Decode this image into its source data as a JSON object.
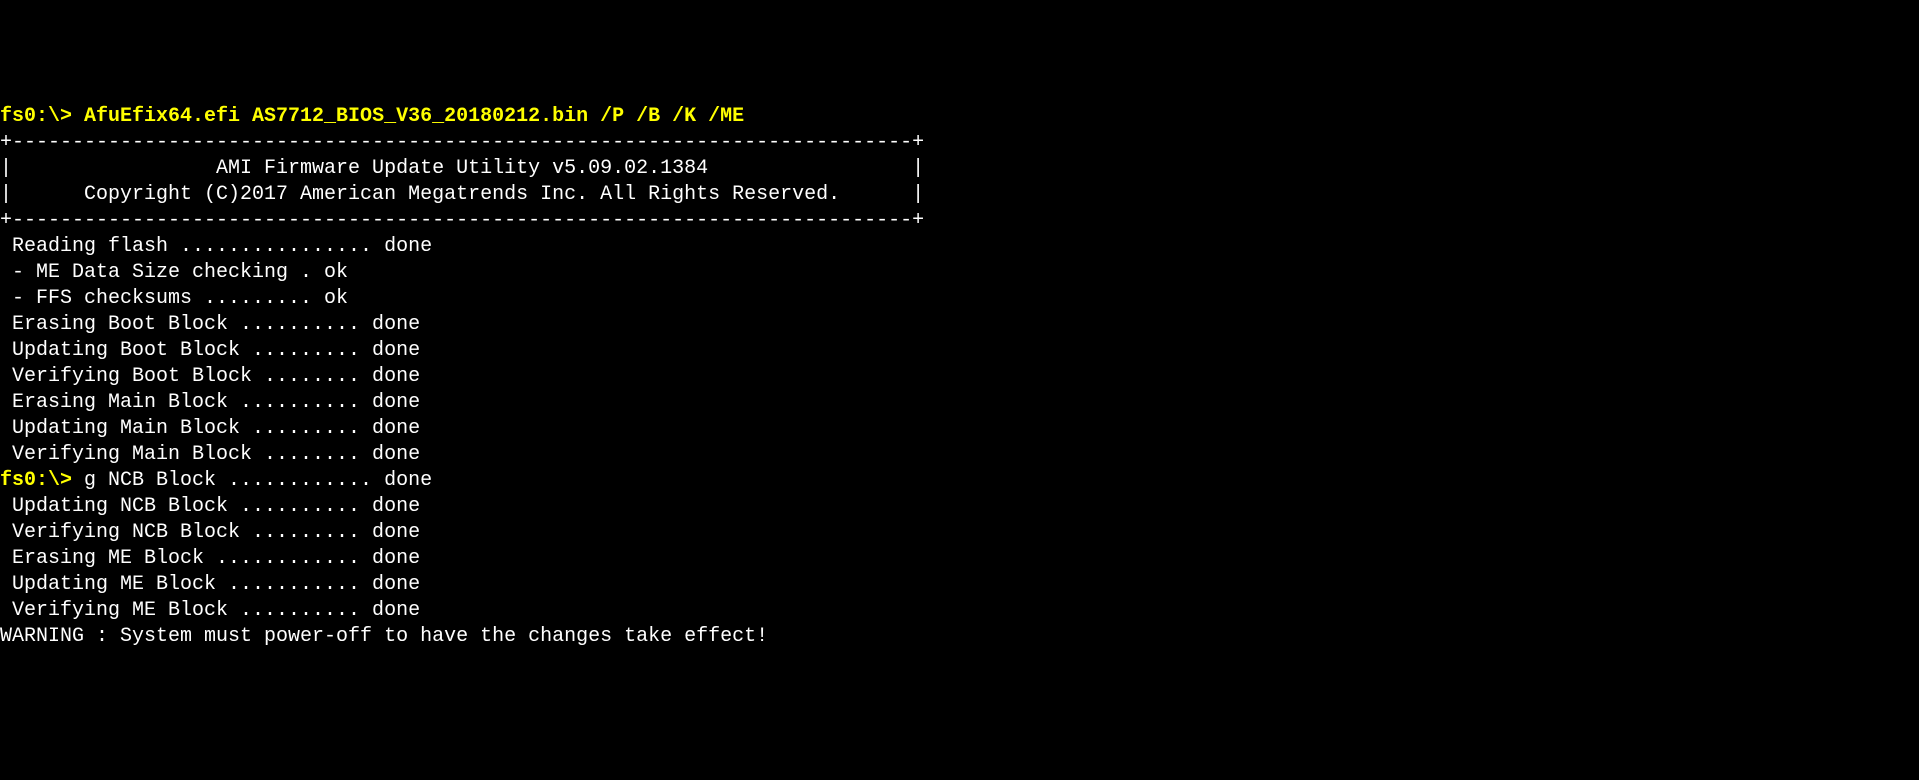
{
  "prompt1": {
    "prefix": "fs0:\\> ",
    "cmd": "AfuEfix64.efi AS7712_BIOS_V36_20180212.bin /P /B /K /ME"
  },
  "header": {
    "border_top": "+---------------------------------------------------------------------------+",
    "title": "|                 AMI Firmware Update Utility v5.09.02.1384                 |",
    "copyright": "|      Copyright (C)2017 American Megatrends Inc. All Rights Reserved.      |",
    "border_bottom": "+---------------------------------------------------------------------------+"
  },
  "lines": [
    " Reading flash ................ done",
    " - ME Data Size checking . ok",
    " - FFS checksums ......... ok",
    " Erasing Boot Block .......... done",
    " Updating Boot Block ......... done",
    " Verifying Boot Block ........ done",
    " Erasing Main Block .......... done",
    " Updating Main Block ......... done",
    " Verifying Main Block ........ done"
  ],
  "prompt2": {
    "prefix": "fs0:\\> ",
    "rest": "g NCB Block ............ done"
  },
  "lines2": [
    " Updating NCB Block .......... done",
    " Verifying NCB Block ......... done",
    " Erasing ME Block ............ done",
    " Updating ME Block ........... done",
    " Verifying ME Block .......... done",
    "WARNING : System must power-off to have the changes take effect!"
  ]
}
